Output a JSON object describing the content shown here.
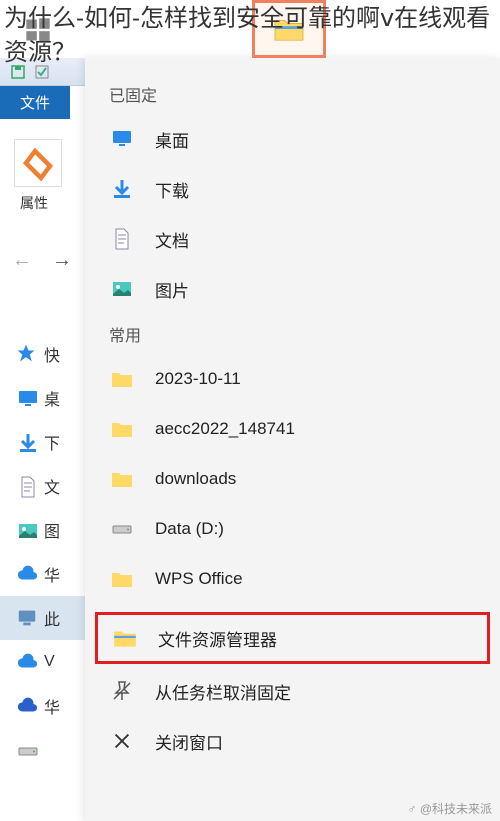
{
  "overlay_question": "为什么-如何-怎样找到安全可靠的啊ⅴ在线观看资源？",
  "qat": {
    "save_icon": "save",
    "undo_icon": "undo"
  },
  "file_tab": "文件",
  "properties": {
    "label": "属性"
  },
  "nav": {
    "back": "←",
    "forward": "→"
  },
  "sidebar_partial": [
    {
      "icon": "star",
      "label": "快",
      "color": "#2a8ae8"
    },
    {
      "icon": "monitor",
      "label": "桌",
      "color": "#2a8ae8"
    },
    {
      "icon": "down",
      "label": "下",
      "color": "#2a8ae8"
    },
    {
      "icon": "doc",
      "label": "文",
      "color": "#aac"
    },
    {
      "icon": "pic",
      "label": "图",
      "color": "#4ac"
    },
    {
      "icon": "cloud",
      "label": "华",
      "color": "#2a8ae8"
    },
    {
      "icon": "pc",
      "label": "此",
      "color": "#6090c0",
      "selected": true
    },
    {
      "icon": "cloud",
      "label": "V",
      "color": "#2a8ae8"
    },
    {
      "icon": "cloud",
      "label": "华",
      "color": "#2a60c8"
    },
    {
      "icon": "drive",
      "label": "",
      "color": "#888"
    }
  ],
  "menu": {
    "pinned_header": "已固定",
    "pinned": [
      {
        "icon": "desktop",
        "label": "桌面"
      },
      {
        "icon": "download",
        "label": "下载"
      },
      {
        "icon": "document",
        "label": "文档"
      },
      {
        "icon": "picture",
        "label": "图片"
      }
    ],
    "frequent_header": "常用",
    "frequent": [
      {
        "icon": "folder",
        "label": "2023-10-11"
      },
      {
        "icon": "folder",
        "label": "aecc2022_148741"
      },
      {
        "icon": "folder",
        "label": "downloads"
      },
      {
        "icon": "drive",
        "label": "Data (D:)"
      },
      {
        "icon": "folder",
        "label": "WPS Office"
      }
    ],
    "actions": [
      {
        "icon": "explorer",
        "label": "文件资源管理器",
        "highlighted": true
      },
      {
        "icon": "unpin",
        "label": "从任务栏取消固定"
      },
      {
        "icon": "close",
        "label": "关闭窗口"
      }
    ]
  },
  "watermark": "@科技未来派"
}
